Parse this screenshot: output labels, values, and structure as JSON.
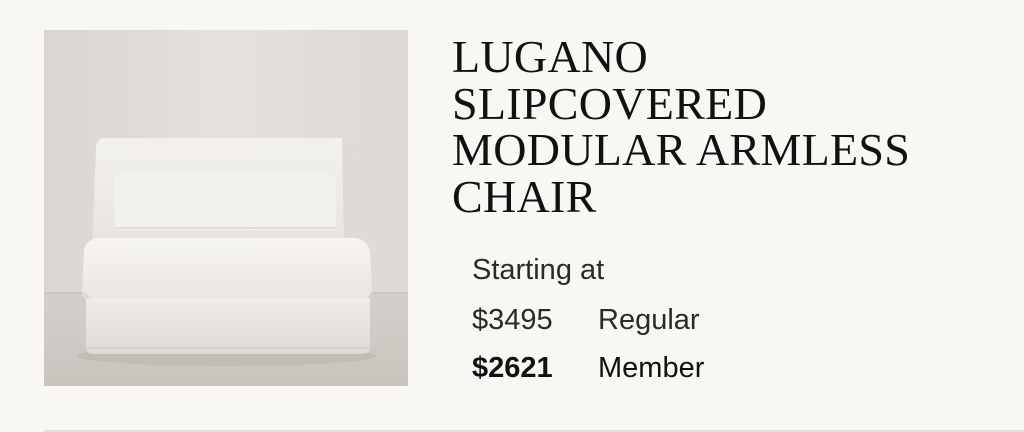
{
  "product": {
    "title_lines": [
      "LUGANO",
      "SLIPCOVERED",
      "MODULAR ARMLESS",
      "CHAIR"
    ],
    "image_alt": "white slipcovered armless chair"
  },
  "pricing": {
    "starting_label": "Starting at",
    "regular_price": "$3495",
    "regular_label": "Regular",
    "member_price": "$2621",
    "member_label": "Member"
  },
  "colors": {
    "background": "#f9f7f4",
    "text": "#111111"
  }
}
